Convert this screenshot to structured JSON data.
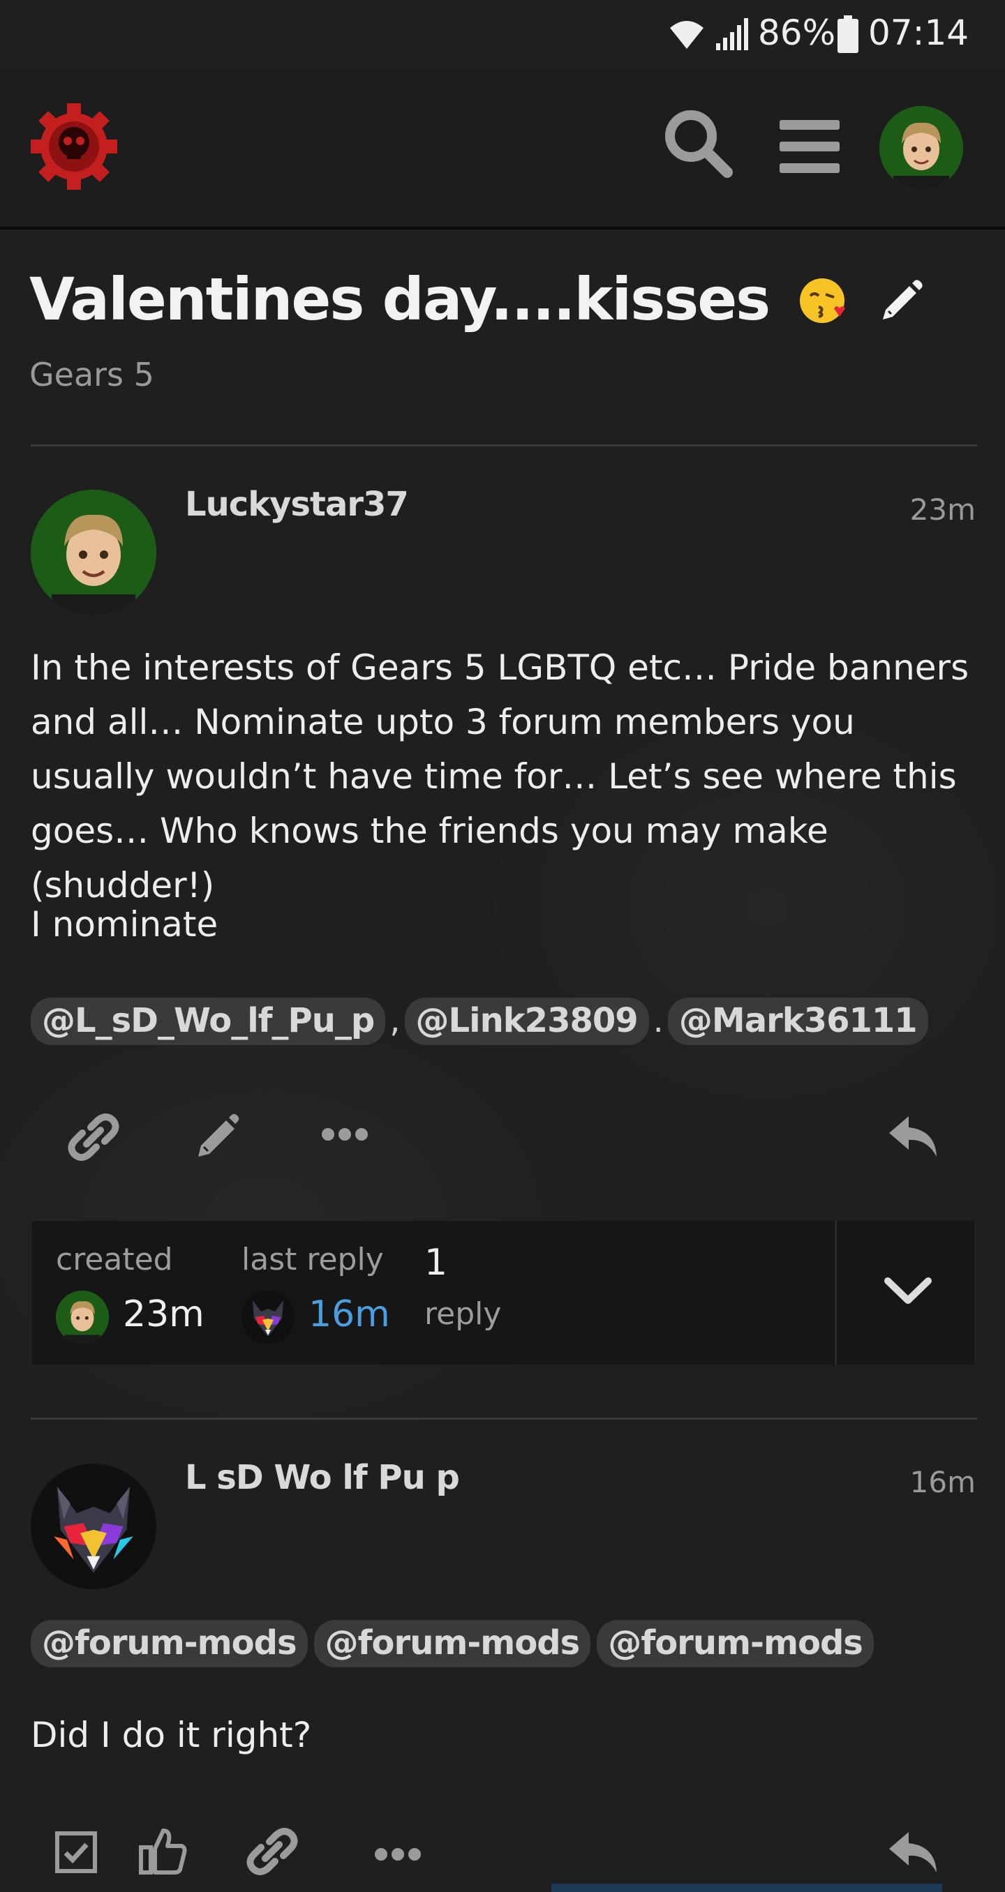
{
  "status_bar": {
    "battery_percent": "86%",
    "time": "07:14"
  },
  "header": {
    "logo_icon": "gears-skull-cog-icon",
    "search_icon": "search-icon",
    "menu_icon": "hamburger-menu-icon",
    "avatar_icon": "user-avatar"
  },
  "topic": {
    "title": "Valentines day....kisses",
    "category": "Gears 5"
  },
  "posts": [
    {
      "username": "Luckystar37",
      "time": "23m",
      "paragraph1": "In the interests of Gears 5 LGBTQ etc… Pride banners and all… Nominate upto 3 forum members you usually wouldn’t have time for… Let’s see where this goes… Who knows the friends you may make (shudder!)",
      "paragraph2": "I nominate",
      "mentions": [
        "@L_sD_Wo_lf_Pu_p",
        "@Link23809",
        "@Mark36111"
      ],
      "separators": [
        ",",
        "."
      ]
    },
    {
      "username": "L sD Wo lf Pu p",
      "time": "16m",
      "mentions": [
        "@forum-mods",
        "@forum-mods",
        "@forum-mods"
      ],
      "paragraph1": "Did I do it right?"
    }
  ],
  "topic_map": {
    "created_label": "created",
    "created_time": "23m",
    "last_reply_label": "last reply",
    "last_reply_time": "16m",
    "reply_count": "1",
    "reply_label": "reply"
  },
  "colors": {
    "background": "#1f1f1f",
    "accent_link": "#4a9fe0",
    "logo_red": "#c41f1f",
    "mention_bg": "#3a3a3a"
  }
}
